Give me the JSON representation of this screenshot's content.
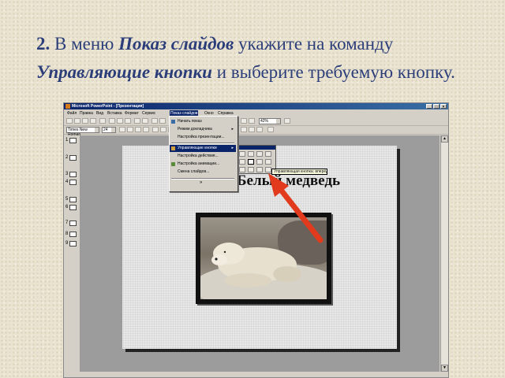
{
  "instruction": {
    "num": "2.",
    "t1": "В меню",
    "menu": "Показ слайдов",
    "t2": "укажите на команду",
    "cmd": "Управляющие кнопки",
    "t3": "и выберите требуемую кнопку."
  },
  "window": {
    "title": "Microsoft PowerPoint - [Презентация]",
    "controls": [
      "_",
      "□",
      "×"
    ]
  },
  "menubar": {
    "items": [
      "Файл",
      "Правка",
      "Вид",
      "Вставка",
      "Формат",
      "Сервис",
      "Показ слайдов",
      "Окно",
      "Справка"
    ]
  },
  "toolbar": {
    "zoom": "42%",
    "font": "Times New Roman",
    "size": "24"
  },
  "outline": {
    "numbers": [
      "1",
      "2",
      "3",
      "4",
      "5",
      "6",
      "7",
      "8",
      "9"
    ]
  },
  "slide_show_menu": {
    "items": [
      "Начать показ",
      "Режим докладчика",
      "Настройка презентации...",
      "Управляющие кнопки",
      "Настройка действия...",
      "Настройка анимации...",
      "Смена слайдов..."
    ],
    "more": "»",
    "highlighted": "Управляющие кнопки",
    "submenu_arrow": "▸"
  },
  "slide": {
    "title": "Белый медведь"
  },
  "tooltip": {
    "text": "Управляющая кнопка: вперёд"
  },
  "colors": {
    "instruction_text": "#2c3e7a",
    "menu_highlight": "#0a246a",
    "arrow": "#e23a1c"
  },
  "icons": {
    "action_buttons": [
      "custom",
      "home",
      "help",
      "info",
      "back",
      "forward",
      "beginning",
      "end",
      "return",
      "document",
      "sound",
      "movie"
    ]
  }
}
